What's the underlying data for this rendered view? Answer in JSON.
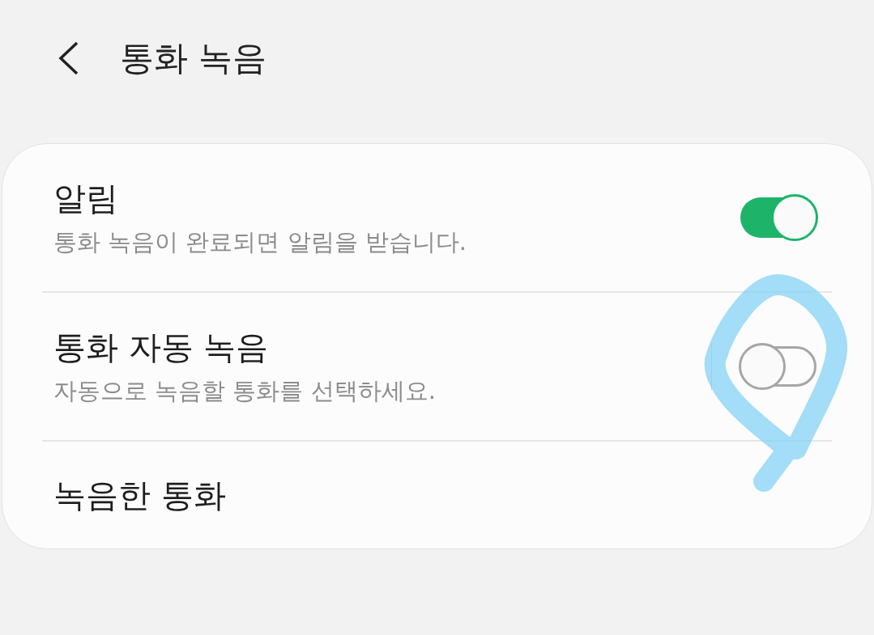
{
  "header": {
    "title": "통화 녹음"
  },
  "settings": [
    {
      "kind": "switch",
      "title": "알림",
      "subtitle": "통화 녹음이 완료되면 알림을 받습니다.",
      "on": true
    },
    {
      "kind": "split-switch",
      "title": "통화 자동 녹음",
      "subtitle": "자동으로 녹음할 통화를 선택하세요.",
      "on": false
    },
    {
      "kind": "link",
      "title": "녹음한 통화"
    }
  ]
}
